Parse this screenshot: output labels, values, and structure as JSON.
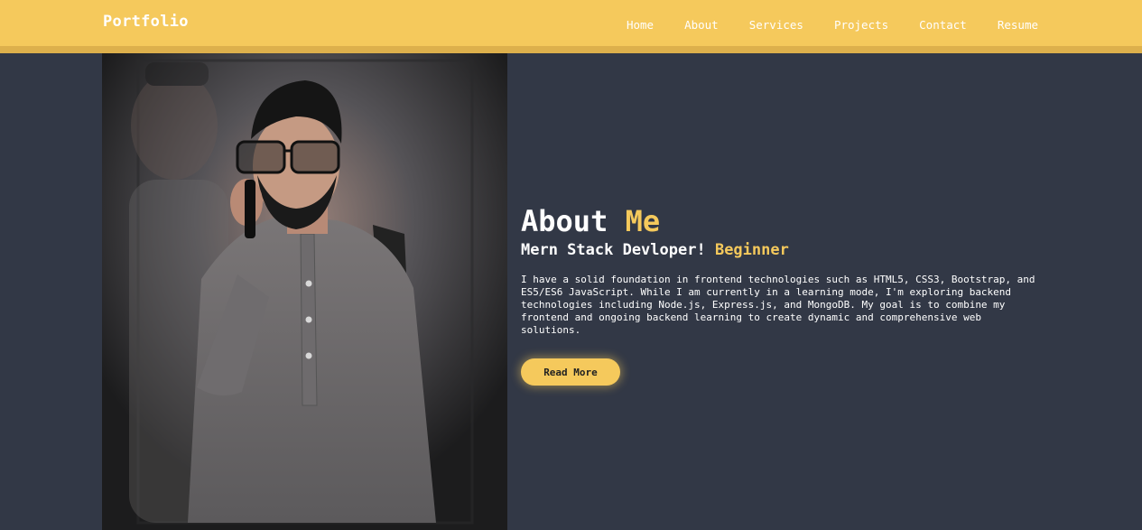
{
  "navbar": {
    "brand": "Portfolio",
    "links": [
      "Home",
      "About",
      "Services",
      "Projects",
      "Contact",
      "Resume"
    ]
  },
  "about": {
    "title_main": "About",
    "title_accent": "Me",
    "subtitle_main": "Mern Stack Devloper!",
    "subtitle_accent": "Beginner",
    "bio": "I have a solid foundation in frontend technologies such as HTML5, CSS3, Bootstrap, and ES5/ES6 JavaScript. While I am currently in a learning mode, I'm exploring backend technologies including Node.js, Express.js, and MongoDB. My goal is to combine my frontend and ongoing backend learning to create dynamic and comprehensive web solutions.",
    "button_label": "Read More"
  },
  "colors": {
    "accent": "#f5c95c",
    "background": "#323846",
    "text": "#ffffff"
  }
}
